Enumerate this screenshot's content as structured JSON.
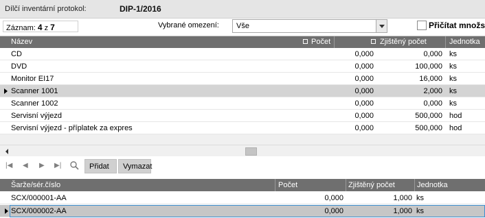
{
  "header": {
    "label": "Dílčí inventární protokol:",
    "value": "DIP-1/2016"
  },
  "filter": {
    "zaznam_label": "Záznam:",
    "zaznam_current": "4",
    "zaznam_sep": "z",
    "zaznam_total": "7",
    "omezeni_label": "Vybrané omezení:",
    "omezeni_value": "Vše",
    "pricitat_label": "Přičítat množství",
    "pricitat_checked": false
  },
  "grid_main": {
    "columns": [
      "Název",
      "Počet",
      "Zjištěný počet",
      "Jednotka"
    ],
    "rows": [
      {
        "nazev": "CD",
        "pocet": "0,000",
        "zjisteny": "0,000",
        "jednotka": "ks"
      },
      {
        "nazev": "DVD",
        "pocet": "0,000",
        "zjisteny": "100,000",
        "jednotka": "ks"
      },
      {
        "nazev": "Monitor EI17",
        "pocet": "0,000",
        "zjisteny": "16,000",
        "jednotka": "ks"
      },
      {
        "nazev": "Scanner 1001",
        "pocet": "0,000",
        "zjisteny": "2,000",
        "jednotka": "ks"
      },
      {
        "nazev": "Scanner 1002",
        "pocet": "0,000",
        "zjisteny": "0,000",
        "jednotka": "ks"
      },
      {
        "nazev": "Servisní výjezd",
        "pocet": "0,000",
        "zjisteny": "500,000",
        "jednotka": "hod"
      },
      {
        "nazev": "Servisní výjezd - příplatek za expres",
        "pocet": "0,000",
        "zjisteny": "500,000",
        "jednotka": "hod"
      }
    ],
    "selected_index": 3
  },
  "toolbar": {
    "icons": [
      "first-record-icon",
      "previous-record-icon",
      "next-record-icon",
      "last-record-icon",
      "search-icon"
    ],
    "add_label": "Přidat",
    "delete_label": "Vymazat"
  },
  "grid_serial": {
    "columns": [
      "Šarže/sér.číslo",
      "Počet",
      "Zjištěný počet",
      "Jednotka"
    ],
    "rows": [
      {
        "sarze": "SCX/000001-AA",
        "pocet": "0,000",
        "zjisteny": "1,000",
        "jednotka": "ks"
      },
      {
        "sarze": "SCX/000002-AA",
        "pocet": "0,000",
        "zjisteny": "1,000",
        "jednotka": "ks"
      }
    ],
    "selected_index": 1
  }
}
